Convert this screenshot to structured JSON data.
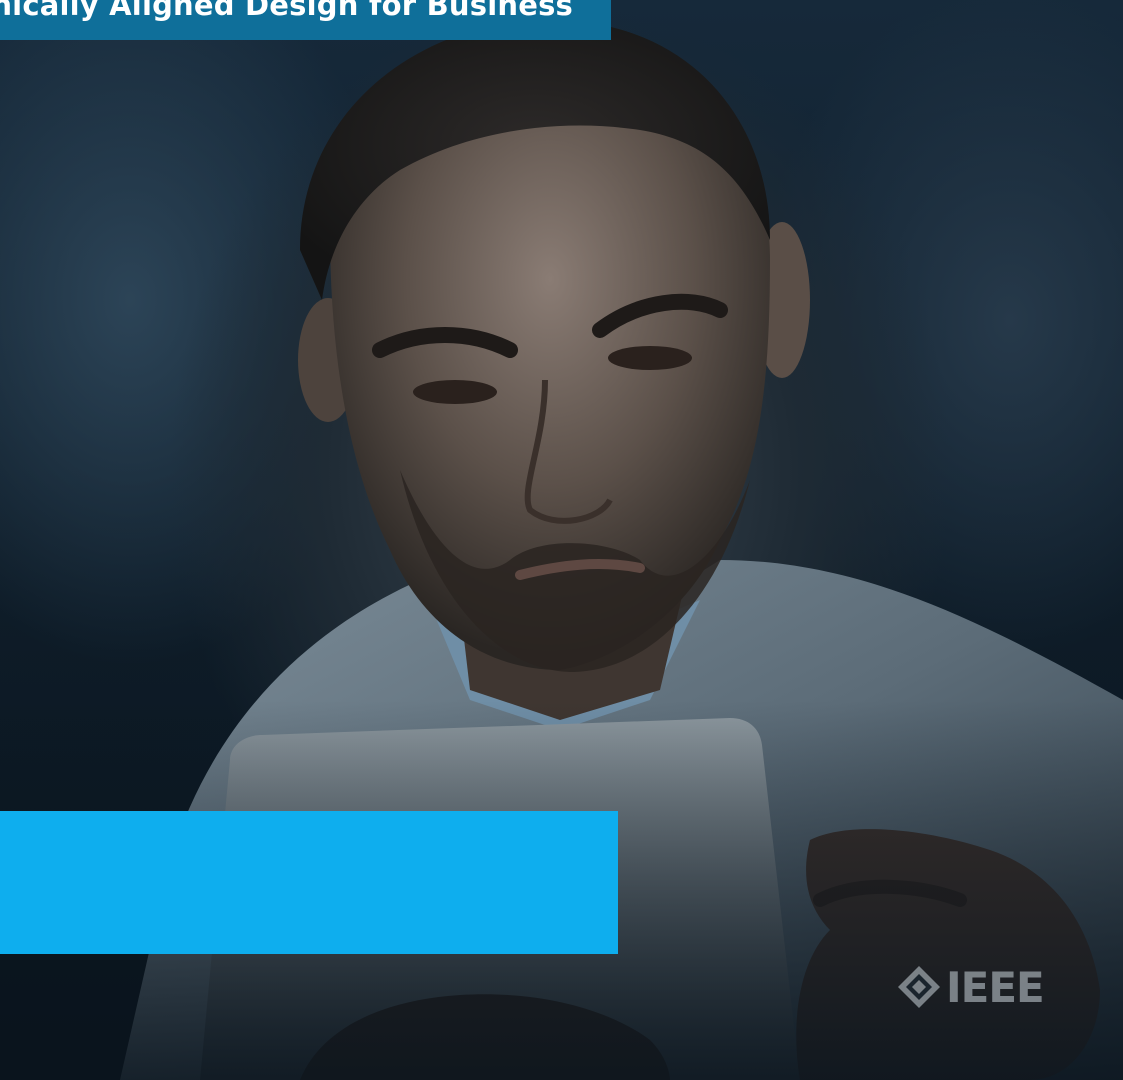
{
  "banner": {
    "title": "Ethically Aligned Design for Business"
  },
  "logo": {
    "text": "IEEE"
  },
  "colors": {
    "banner": "#0f6f9a",
    "blue_bar": "#0eaeee",
    "background": "#0e1c28"
  },
  "photo": {
    "subject": "person-in-lab-coat-reading-tablet"
  }
}
